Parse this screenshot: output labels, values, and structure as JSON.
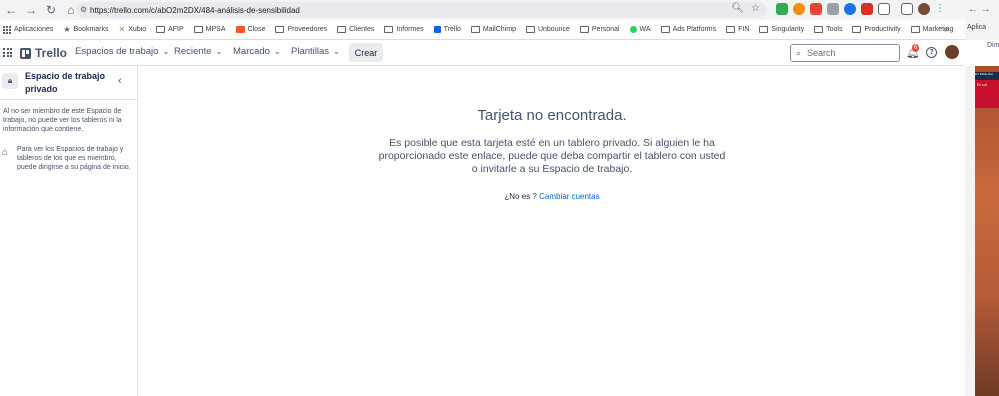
{
  "browser": {
    "url": "https://trello.com/c/abO2m2DX/484-análisis-de-sensibilidad",
    "bookmarks": [
      {
        "label": "Aplicaciones",
        "icon": "apps-icon"
      },
      {
        "label": "Bookmarks",
        "icon": "star-icon"
      },
      {
        "label": "Xubio",
        "icon": "xubio-icon"
      },
      {
        "label": "AFIP",
        "icon": "folder-icon"
      },
      {
        "label": "MPSA",
        "icon": "folder-icon"
      },
      {
        "label": "Close",
        "icon": "close-logo-icon"
      },
      {
        "label": "Proveedores",
        "icon": "folder-icon"
      },
      {
        "label": "Clientes",
        "icon": "folder-icon"
      },
      {
        "label": "Informes",
        "icon": "folder-icon"
      },
      {
        "label": "Trello",
        "icon": "trello-icon"
      },
      {
        "label": "MailChimp",
        "icon": "folder-icon"
      },
      {
        "label": "Unbounce",
        "icon": "folder-icon"
      },
      {
        "label": "Personal",
        "icon": "folder-icon"
      },
      {
        "label": "WA",
        "icon": "whatsapp-icon"
      },
      {
        "label": "Ads Platforms",
        "icon": "folder-icon"
      },
      {
        "label": "FIN",
        "icon": "folder-icon"
      },
      {
        "label": "Singularity",
        "icon": "folder-icon"
      },
      {
        "label": "Tools",
        "icon": "folder-icon"
      },
      {
        "label": "Productivity",
        "icon": "folder-icon"
      },
      {
        "label": "Marketing",
        "icon": "folder-icon"
      }
    ],
    "more_bookmarks": "»"
  },
  "trello": {
    "logo": "Trello",
    "menu": [
      {
        "label": "Espacios de trabajo"
      },
      {
        "label": "Reciente"
      },
      {
        "label": "Marcado"
      },
      {
        "label": "Plantillas"
      }
    ],
    "create": "Crear",
    "search_placeholder": "Search",
    "notifications_count": "6"
  },
  "sidebar": {
    "title": "Espacio de trabajo privado",
    "text1": "Al no ser miembro de este Espacio de trabajo, no puede ver los tableros ni la información que contiene.",
    "text2": "Para ver los Espacios de trabajo y tableros de los que es miembro, puede dirigirse a su página de inicio."
  },
  "main": {
    "title": "Tarjeta no encontrada.",
    "body": "Es posible que esta tarjeta esté en un tablero privado. Si alguien le ha proporcionado este enlace, puede que deba compartir el tablero con usted o invitarle a su Espacio de trabajo.",
    "not_you": "¿No es ?",
    "switch_accounts": "Cambiar cuentas"
  },
  "side_window": {
    "bookmark": "Aplica",
    "tab_label": "Dim",
    "banner_top": "EY ENGLISH",
    "banner_text": "El col"
  }
}
